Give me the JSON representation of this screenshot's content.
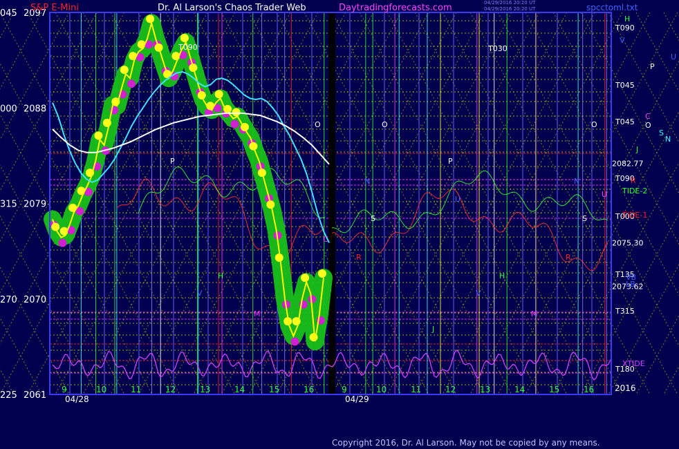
{
  "header": {
    "instrument": "S&P E-Mini",
    "author": "Dr. Al Larson's Chaos Trader Web",
    "site": "Daytradingforecasts.com",
    "file": "spcctoml.txt",
    "stamp1": "04/29/2016 20:20 UT",
    "stamp2": "04/29/2016 20:20 UT"
  },
  "footer": {
    "copyright": "Copyright 2016, Dr. Al Larson. May not be copied by any means."
  },
  "colors": {
    "background": "#00004e",
    "frame": "#3a3aff",
    "price": "#ffff00",
    "ma_fast": "#40e0ff",
    "ma_slow": "#ffffff",
    "halo": "#18c018",
    "blob_yellow": "#ffff20",
    "blob_magenta": "#d020d0",
    "xtide": "#d040ff",
    "tide1": "#ff3030",
    "tide2": "#30ff30",
    "grid_yellow": "#e0e000",
    "red_line": "#ff2020",
    "grid_magenta": "#ff30ff"
  },
  "chart_data": {
    "type": "line",
    "title": "S&P E-Mini",
    "xlabel": "",
    "ylabel": "",
    "ylim": [
      2061,
      2097
    ],
    "left_scale": [
      {
        "value": 2097,
        "label": "2097",
        "alt": "045"
      },
      {
        "value": 2088,
        "label": "2088",
        "alt": "000"
      },
      {
        "value": 2079,
        "label": "2079",
        "alt": "315"
      },
      {
        "value": 2070,
        "label": "2070",
        "alt": "270"
      },
      {
        "value": 2061,
        "label": "2061",
        "alt": "225"
      }
    ],
    "days": [
      {
        "date": "04/28",
        "hours": [
          "9",
          "10",
          "11",
          "12",
          "13",
          "14",
          "15",
          "16"
        ]
      },
      {
        "date": "04/29",
        "hours": [
          "9",
          "10",
          "11",
          "12",
          "13",
          "14",
          "15",
          "16"
        ]
      }
    ],
    "year": "2016",
    "price_levels": [
      {
        "label": "2082.77",
        "value": 2082.77
      },
      {
        "label": "2075.30",
        "value": 2075.3
      },
      {
        "label": "2073.62",
        "value": 2071.2
      }
    ],
    "right_labels": [
      "T090",
      "T045",
      "T045",
      "T090",
      "T000",
      "T315",
      "T180",
      "T135",
      "H",
      "V",
      "P",
      "U",
      "C",
      "O",
      "S",
      "N",
      "J",
      "R",
      "TIDE-2",
      "TIDE-1",
      "VB",
      "LB",
      "XTIDE"
    ],
    "inline_labels": [
      "T090",
      "T030",
      "O",
      "O",
      "O",
      "P",
      "P",
      "N",
      "N",
      "S",
      "S",
      "M",
      "M",
      "H",
      "H",
      "V",
      "V",
      "R",
      "R",
      "U",
      "U",
      "C",
      "J"
    ],
    "series": [
      {
        "id": "price",
        "values": [
          2077.5,
          2076.4,
          2075.8,
          2076.0,
          2077.0,
          2078.2,
          2078.8,
          2079.8,
          2080.6,
          2081.5,
          2083.0,
          2085.0,
          2084.5,
          2086.2,
          2088.3,
          2088.2,
          2089.8,
          2091.2,
          2090.8,
          2092.5,
          2093.3,
          2093.6,
          2094.5,
          2096.0,
          2094.5,
          2093.3,
          2092.0,
          2090.8,
          2091.5,
          2092.5,
          2093.5,
          2094.2,
          2092.8,
          2091.4,
          2090.0,
          2088.8,
          2088.1,
          2087.8,
          2088.5,
          2088.9,
          2088.0,
          2087.5,
          2087.0,
          2087.2,
          2086.5,
          2085.8,
          2085.2,
          2084.0,
          2083.0,
          2081.5,
          2080.0,
          2078.5,
          2076.5,
          2073.5,
          2070.0,
          2067.5,
          2066.5,
          2067.5,
          2070.0,
          2071.6,
          2070.5,
          2066.0,
          2068.5,
          2072.0
        ]
      },
      {
        "id": "ma-fast",
        "values": [
          2088.5,
          2087.2,
          2085.5,
          2084.0,
          2082.8,
          2081.9,
          2081.3,
          2081.0,
          2081.2,
          2081.8,
          2082.4,
          2083.2,
          2084.2,
          2085.2,
          2086.3,
          2087.2,
          2088.0,
          2088.8,
          2089.5,
          2090.1,
          2090.6,
          2091.0,
          2091.3,
          2091.4,
          2091.2,
          2090.8,
          2090.3,
          2090.0,
          2090.2,
          2090.7,
          2090.8,
          2090.6,
          2090.2,
          2089.7,
          2089.2,
          2088.9,
          2088.8,
          2088.9,
          2088.6,
          2088.0,
          2087.3,
          2086.3,
          2085.4,
          2084.3,
          2083.2,
          2081.8,
          2080.0,
          2078.0,
          2076.4,
          2075.3
        ]
      },
      {
        "id": "ma-slow",
        "values": [
          2086.0,
          2085.2,
          2084.5,
          2084.0,
          2083.8,
          2083.8,
          2084.0,
          2084.2,
          2084.5,
          2084.8,
          2085.2,
          2085.6,
          2086.0,
          2086.3,
          2086.6,
          2086.8,
          2087.0,
          2087.2,
          2087.3,
          2087.4,
          2087.5,
          2087.5,
          2087.5,
          2087.4,
          2087.3,
          2087.0,
          2086.7,
          2086.3,
          2085.8,
          2085.2,
          2084.5,
          2083.6,
          2082.7
        ]
      }
    ]
  }
}
